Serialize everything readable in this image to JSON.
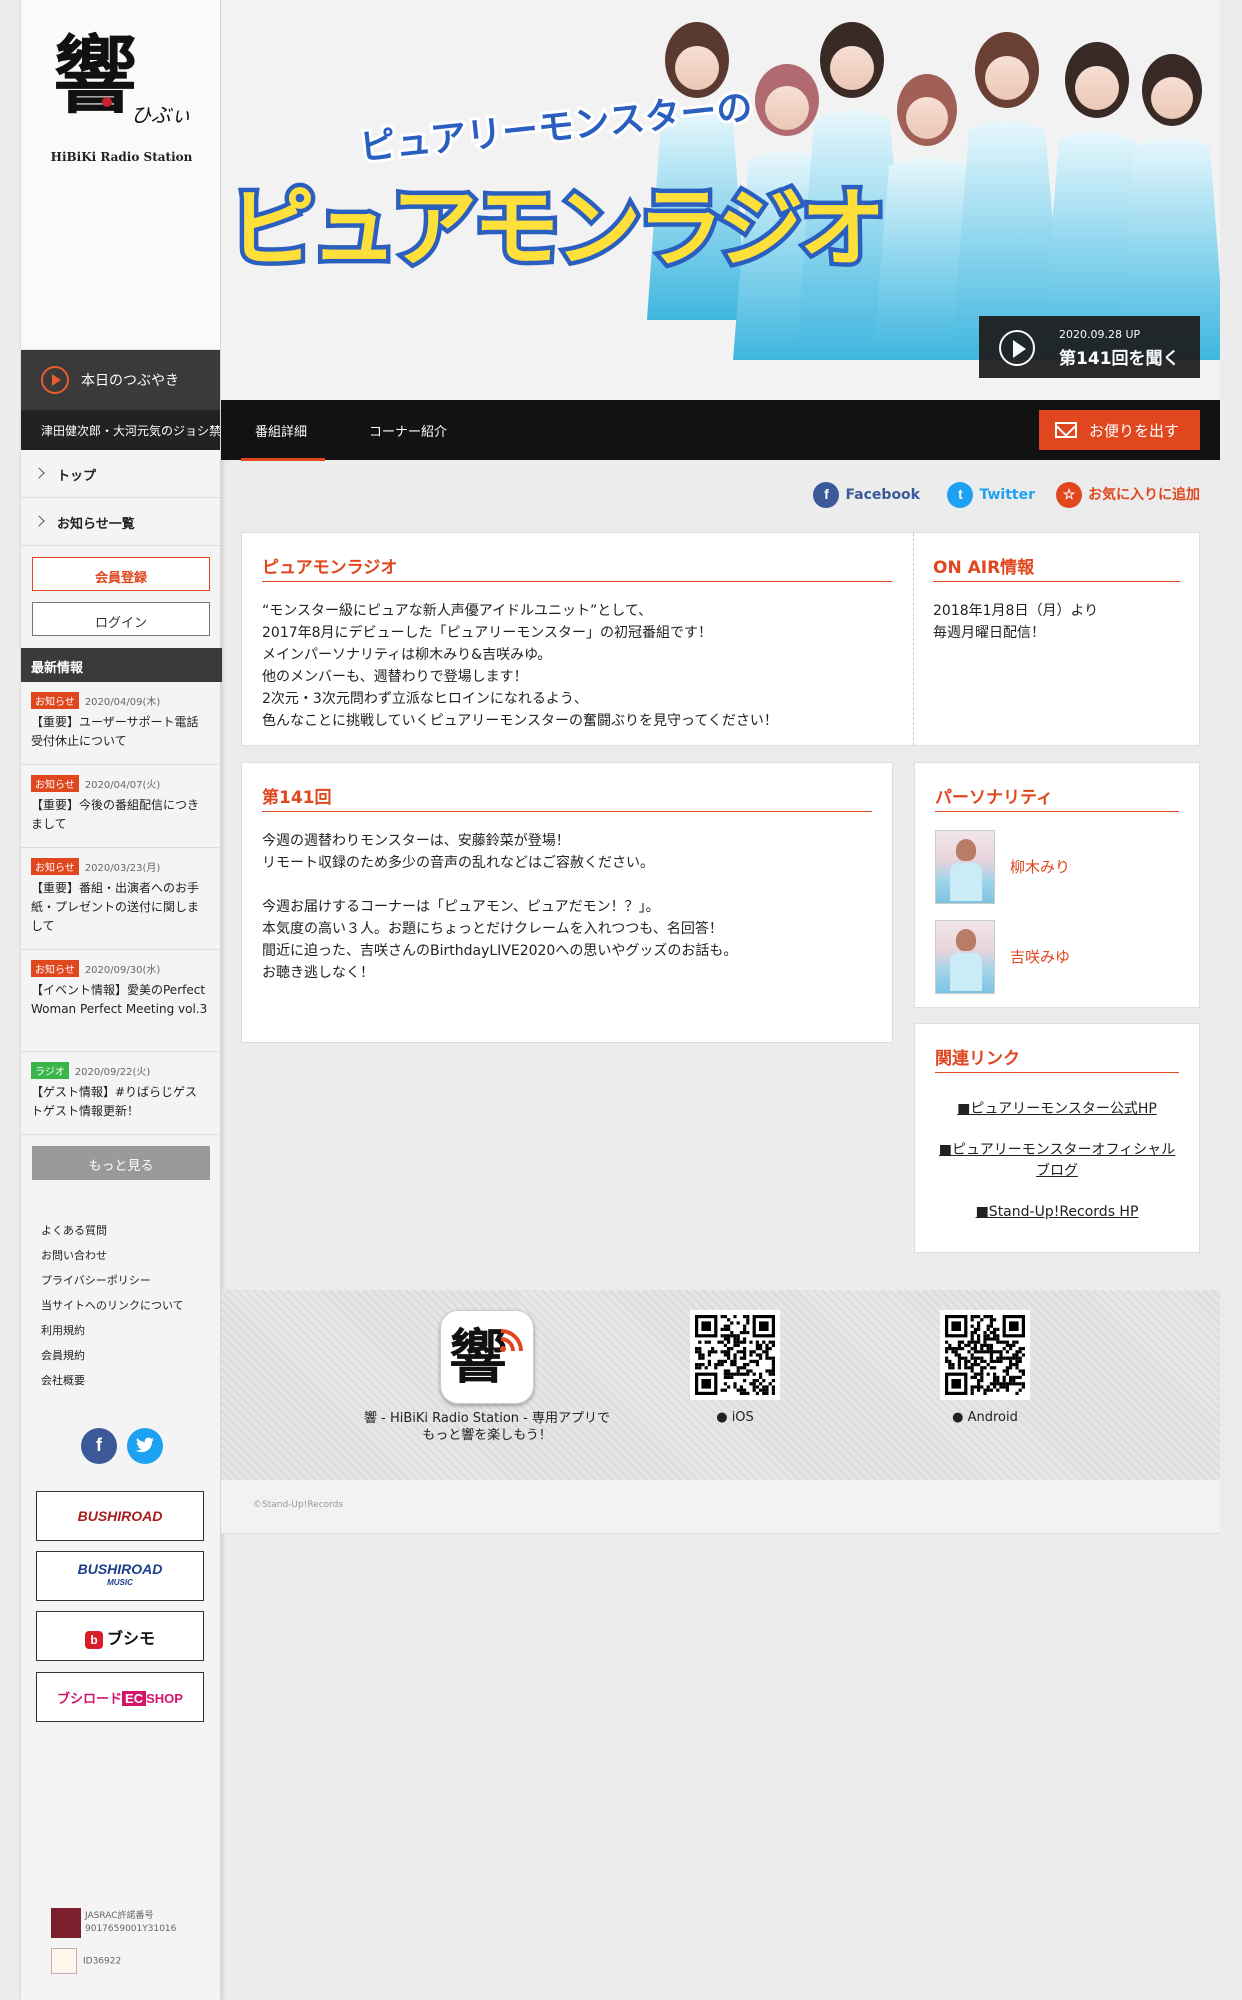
{
  "logo": {
    "caption": "HiBiKi Radio Station"
  },
  "sidebar": {
    "tsubuyaki_label": "本日のつぶやき",
    "ticker": "津田健次郎・大河元気のジョシ禁",
    "nav": [
      {
        "label": "トップ"
      },
      {
        "label": "お知らせ一覧"
      }
    ],
    "register_label": "会員登録",
    "login_label": "ログイン",
    "latest_heading": "最新情報",
    "news": [
      {
        "tag": "お知らせ",
        "date": "2020/04/09(木)",
        "title": "【重要】ユーザーサポート電話受付休止について"
      },
      {
        "tag": "お知らせ",
        "date": "2020/04/07(火)",
        "title": "【重要】今後の番組配信につきまして"
      },
      {
        "tag": "お知らせ",
        "date": "2020/03/23(月)",
        "title": "【重要】番組・出演者へのお手紙・プレゼントの送付に関しまして"
      },
      {
        "tag": "お知らせ",
        "date": "2020/09/30(水)",
        "title": "【イベント情報】愛美のPerfect Woman Perfect Meeting vol.3"
      },
      {
        "tag": "ラジオ",
        "date": "2020/09/22(火)",
        "title": "【ゲスト情報】#りばらじゲストゲスト情報更新！"
      }
    ],
    "more_label": "もっと見る",
    "footer_links": [
      "よくある質問",
      "お問い合わせ",
      "プライバシーポリシー",
      "当サイトへのリンクについて",
      "利用規約",
      "会員規約",
      "会社概要"
    ],
    "banners": {
      "bushiroad": "BUSHIROAD",
      "bushiroad_music_main": "BUSHIROAD",
      "bushiroad_music_sub": "MUSIC",
      "bushimo": "ブシモ",
      "ec_main": "ブシロード",
      "ec_badge": "EC",
      "ec_tail": "SHOP"
    },
    "jasrac_label": "JASRAC許諾番号",
    "jasrac_number": "9017659001Y31016",
    "id_label": "ID36922"
  },
  "hero": {
    "subtitle": "ピュアリーモンスターの",
    "title": "ピュアモンラジオ",
    "listen_date": "2020.09.28 UP",
    "listen_label": "第141回を聞く"
  },
  "tabs": [
    {
      "label": "番組詳細"
    },
    {
      "label": "コーナー紹介"
    }
  ],
  "mail_label": "お便りを出す",
  "share": {
    "facebook": "Facebook",
    "twitter": "Twitter",
    "favorite": "お気に入りに追加"
  },
  "program": {
    "title": "ピュアモンラジオ",
    "description": "“モンスター級にピュアな新人声優アイドルユニット”として、\n2017年8月にデビューした「ピュアリーモンスター」の初冠番組です！\nメインパーソナリティは柳木みり&吉咲みゆ。\n他のメンバーも、週替わりで登場します！\n2次元・3次元問わず立派なヒロインになれるよう、\n色んなことに挑戦していくピュアリーモンスターの奮闘ぶりを見守ってください！",
    "onair_heading": "ON AIR情報",
    "onair_text": "2018年1月8日（月）より\n毎週月曜日配信！"
  },
  "episode": {
    "title": "第141回",
    "text": "今週の週替わりモンスターは、安藤鈴菜が登場！\nリモート収録のため多少の音声の乱れなどはご容赦ください。\n\n今週お届けするコーナーは「ピュアモン、ピュアだモン！？」。\n本気度の高い３人。お題にちょっとだけクレームを入れつつも、名回答！\n間近に迫った、吉咲さんのBirthdayLIVE2020への思いやグッズのお話も。\nお聴き逃しなく！"
  },
  "personality": {
    "heading": "パーソナリティ",
    "people": [
      {
        "name": "柳木みり"
      },
      {
        "name": "吉咲みゆ"
      }
    ]
  },
  "related": {
    "heading": "関連リンク",
    "links": [
      "■ピュアリーモンスター公式HP",
      "■ピュアリーモンスターオフィシャルブログ",
      "■Stand-Up!Records HP"
    ]
  },
  "app": {
    "description": "響 - HiBiKi Radio Station - 専用アプリで\nもっと響を楽しもう！",
    "ios": "iOS",
    "android": "Android"
  },
  "copyright": "©Stand-Up!Records",
  "colors": {
    "accent": "#e0471f",
    "facebook": "#3b5998",
    "twitter": "#1da1f2",
    "radio_tag": "#39b54a"
  }
}
